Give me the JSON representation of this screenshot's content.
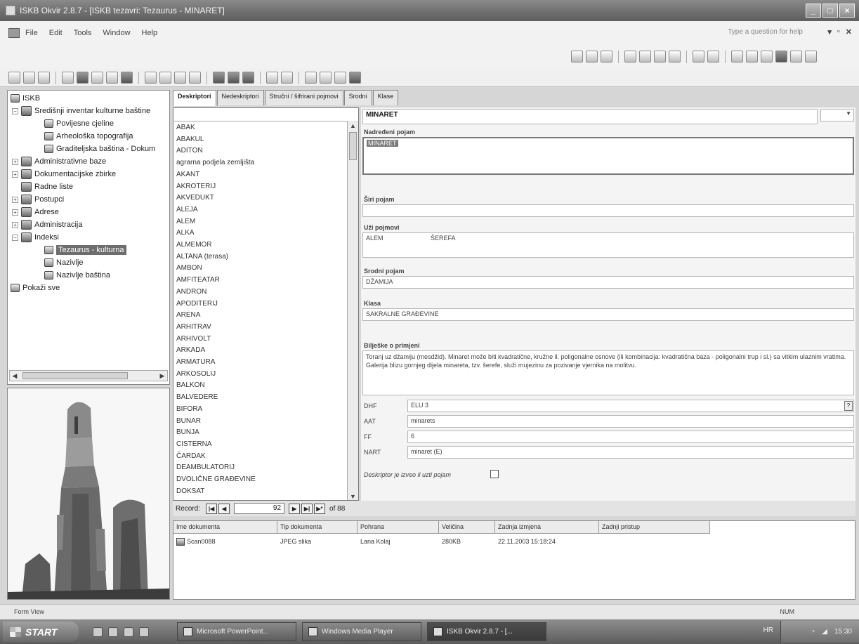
{
  "window": {
    "title": "ISKB Okvir 2.8.7 - [ISKB tezavri: Tezaurus - MINARET]"
  },
  "menu": {
    "items": [
      "File",
      "Edit",
      "Tools",
      "Window",
      "Help"
    ],
    "help_placeholder": "Type a question for help"
  },
  "tree": {
    "items": [
      {
        "label": "ISKB",
        "level": 0
      },
      {
        "label": "Središnji inventar kulturne baštine",
        "level": 1
      },
      {
        "label": "Povijesne cjeline",
        "level": 2
      },
      {
        "label": "Arheološka topografija",
        "level": 2
      },
      {
        "label": "Graditeljska baština - Dokum",
        "level": 2
      },
      {
        "label": "Administrativne baze",
        "level": 1
      },
      {
        "label": "Dokumentacijske zbirke",
        "level": 1
      },
      {
        "label": "Radne liste",
        "level": 1
      },
      {
        "label": "Postupci",
        "level": 1
      },
      {
        "label": "Adrese",
        "level": 1
      },
      {
        "label": "Administracija",
        "level": 1
      },
      {
        "label": "Indeksi",
        "level": 1
      },
      {
        "label": "Tezaurus - kulturna",
        "level": 2,
        "selected": true
      },
      {
        "label": "Nazivlje",
        "level": 2
      },
      {
        "label": "Nazivlje baština",
        "level": 2
      },
      {
        "label": "Pokaži sve",
        "level": 0
      }
    ]
  },
  "tabs": [
    "Deskriptori",
    "Nedeskriptori",
    "Stručni / šifrirani pojmovi",
    "Srodni",
    "Klase"
  ],
  "terms": [
    "ABAK",
    "ABAKUL",
    "ADITON",
    "agrarna podjela zemljišta",
    "AKANT",
    "AKROTERIJ",
    "AKVEDUKT",
    "ALEJA",
    "ALEM",
    "ALKA",
    "ALMEMOR",
    "ALTANA (terasa)",
    "AMBON",
    "AMFITEATAR",
    "ANDRON",
    "APODITERIJ",
    "ARENA",
    "ARHITRAV",
    "ARHIVOLT",
    "ARKADA",
    "ARMATURA",
    "ARKOSOLIJ",
    "BALKON",
    "BALVEDERE",
    "BIFORA",
    "BUNAR",
    "BUNJA",
    "CISTERNA",
    "ČARDAK",
    "DEAMBULATORIJ",
    "DVOLIČNE GRAĐEVINE",
    "DOKSAT"
  ],
  "navigator": {
    "label": "Record:",
    "current": "92",
    "of": "of 88"
  },
  "detail": {
    "term": "MINARET",
    "hierarchy_label": "Nadređeni pojam",
    "hierarchy_value": "MINARET",
    "broader_label": "Širi pojam",
    "narrower_label": "Uži pojmovi",
    "narrower": [
      {
        "code": "ALEM",
        "desc": "ŠEREFA"
      }
    ],
    "related_label": "Srodni pojam",
    "related_value": "DŽAMIJA",
    "class_label": "Klasa",
    "class_value": "SAKRALNE GRAĐEVINE",
    "scope_label": "Bilješke o primjeni",
    "scope_text": "Toranj uz džamiju (mesdžid). Minaret može biti kvadratične, kružne il. poligonalne osnove (ili kombinacija: kvadratična baza - poligonalni trup i sl.) sa vitkim ulaznim vratima. Galerija blizu gornjeg dijela minareta, tzv. šerefe, služi mujezinu za pozivanje vjernika na molitvu.",
    "codes": [
      {
        "label": "DHF",
        "value": "ELU 3"
      },
      {
        "label": "AAT",
        "value": "minarets"
      },
      {
        "label": "FF",
        "value": "6"
      },
      {
        "label": "NART",
        "value": "minaret (E)"
      }
    ],
    "checkbox_label": "Deskriptor je izveo il uzti pojam"
  },
  "grid": {
    "headers": [
      "Ime dokumenta",
      "Tip dokumenta",
      "Pohrana",
      "Veličina",
      "Zadnja izmjena",
      "Zadnji pristup"
    ],
    "rows": [
      [
        "Scan0088",
        "JPEG slika",
        "Lana Kolaj",
        "280KB",
        "22.11.2003 15:18:24",
        ""
      ]
    ]
  },
  "status": {
    "left": "Form View",
    "right": "NUM"
  },
  "taskbar": {
    "start": "START",
    "tasks": [
      "Microsoft PowerPoint...",
      "Windows Media Player",
      "ISKB Okvir 2.8.7 - [..."
    ],
    "lang": "HR",
    "clock": "15:30"
  }
}
